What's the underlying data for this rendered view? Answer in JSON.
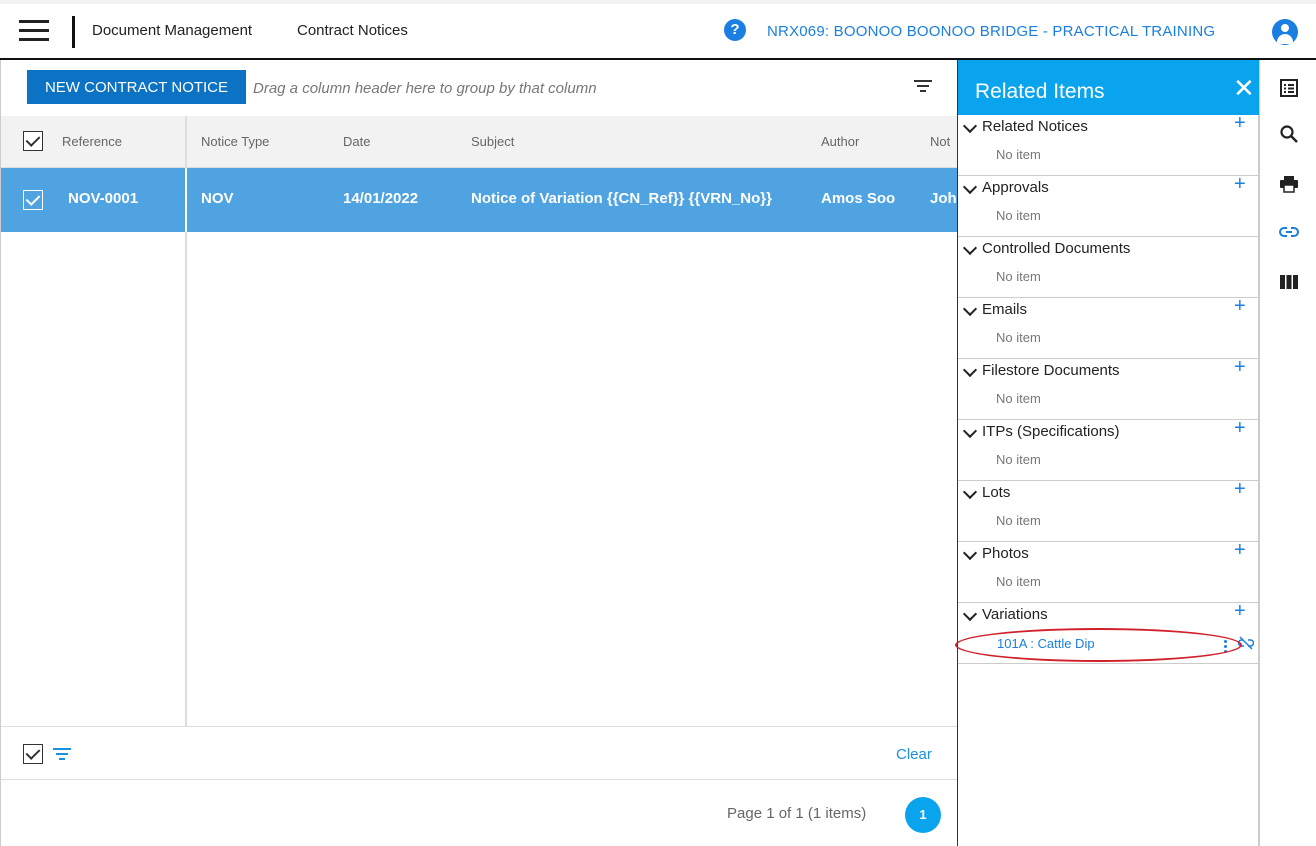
{
  "topbar": {
    "breadcrumb": [
      "Document Management",
      "Contract Notices"
    ],
    "help_symbol": "?",
    "project": "NRX069: BOONOO BOONOO BRIDGE - PRACTICAL TRAINING",
    "icons": {
      "menu": "hamburger-icon",
      "help": "help-icon",
      "user": "user-icon"
    }
  },
  "toolbar": {
    "new_button": "NEW CONTRACT NOTICE",
    "group_hint": "Drag a column header here to group by that column"
  },
  "grid": {
    "columns": [
      "Reference",
      "Notice Type",
      "Date",
      "Subject",
      "Author",
      "Not"
    ],
    "rows": [
      {
        "reference": "NOV-0001",
        "notice_type": "NOV",
        "date": "14/01/2022",
        "subject": "Notice of Variation {{CN_Ref}} {{VRN_No}}",
        "author": "Amos Soo",
        "extra": "Joh"
      }
    ],
    "footer": {
      "clear": "Clear"
    },
    "pager": {
      "text": "Page 1 of 1 (1 items)",
      "current": "1"
    }
  },
  "related_items": {
    "title": "Related Items",
    "close_symbol": "✕",
    "add_symbol": "+",
    "empty_text": "No item",
    "sections": [
      {
        "title": "Related Notices",
        "has_add": true
      },
      {
        "title": "Approvals",
        "has_add": true
      },
      {
        "title": "Controlled Documents",
        "has_add": false
      },
      {
        "title": "Emails",
        "has_add": true
      },
      {
        "title": "Filestore Documents",
        "has_add": true
      },
      {
        "title": "ITPs (Specifications)",
        "has_add": true
      },
      {
        "title": "Lots",
        "has_add": true
      },
      {
        "title": "Photos",
        "has_add": true
      },
      {
        "title": "Variations",
        "has_add": true,
        "item": "101A : Cattle Dip"
      }
    ]
  },
  "rail": {
    "icons": [
      "list-icon",
      "search-icon",
      "print-icon",
      "link-icon",
      "columns-icon"
    ]
  },
  "colors": {
    "accent": "#1a7fe0",
    "panel_header": "#0aa4ee",
    "selected_row": "#4fa3e0",
    "button": "#0b72c4",
    "highlight": "#d0202a"
  }
}
